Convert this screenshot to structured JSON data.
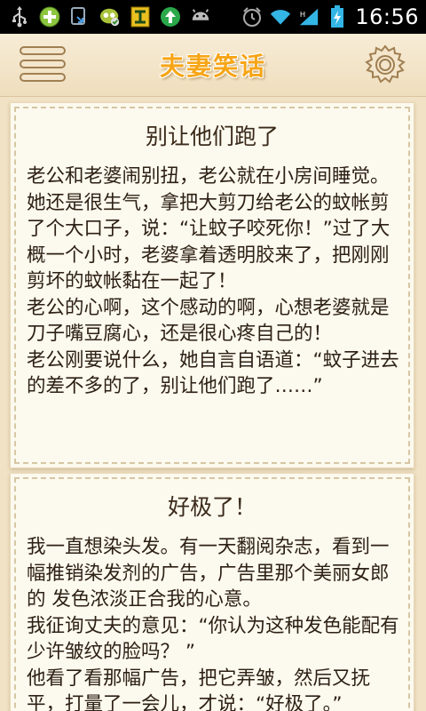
{
  "status_bar": {
    "time": "16:56",
    "icons": [
      "usb-icon",
      "plus-app-icon",
      "sync-icon",
      "app-badge-icon",
      "sim-icon",
      "upload-icon",
      "android-icon",
      "alarm-icon",
      "wifi-icon",
      "signal-icon",
      "battery-charging-icon"
    ]
  },
  "app_bar": {
    "title": "夫妻笑话",
    "menu_icon": "menu-icon",
    "settings_icon": "gear-icon"
  },
  "jokes": [
    {
      "title": "别让他们跑了",
      "body": "老公和老婆闹别扭，老公就在小房间睡觉。\n她还是很生气，拿把大剪刀给老公的蚊帐剪了个大口子，说：“让蚊子咬死你！”过了大概一个小时，老婆拿着透明胶来了，把刚刚剪坏的蚊帐黏在一起了！\n老公的心啊，这个感动的啊，心想老婆就是刀子嘴豆腐心，还是很心疼自己的！\n老公刚要说什么，她自言自语道：“蚊子进去的差不多的了，别让他们跑了……”"
    },
    {
      "title": "好极了！",
      "body": "我一直想染头发。有一天翻阅杂志，看到一幅推销染发剂的广告，广告里那个美丽女郎的 发色浓淡正合我的心意。\n我征询丈夫的意见：“你认为这种发色能配有少许皱纹的脸吗？ ”\n他看了看那幅广告，把它弄皱，然后又抚平，打量了一会儿，才说：“好极了。”"
    }
  ],
  "colors": {
    "background": "#f1e2c5",
    "title_orange": "#f7a516",
    "card_bg": "#fcf9ee",
    "text": "#2d2014"
  }
}
